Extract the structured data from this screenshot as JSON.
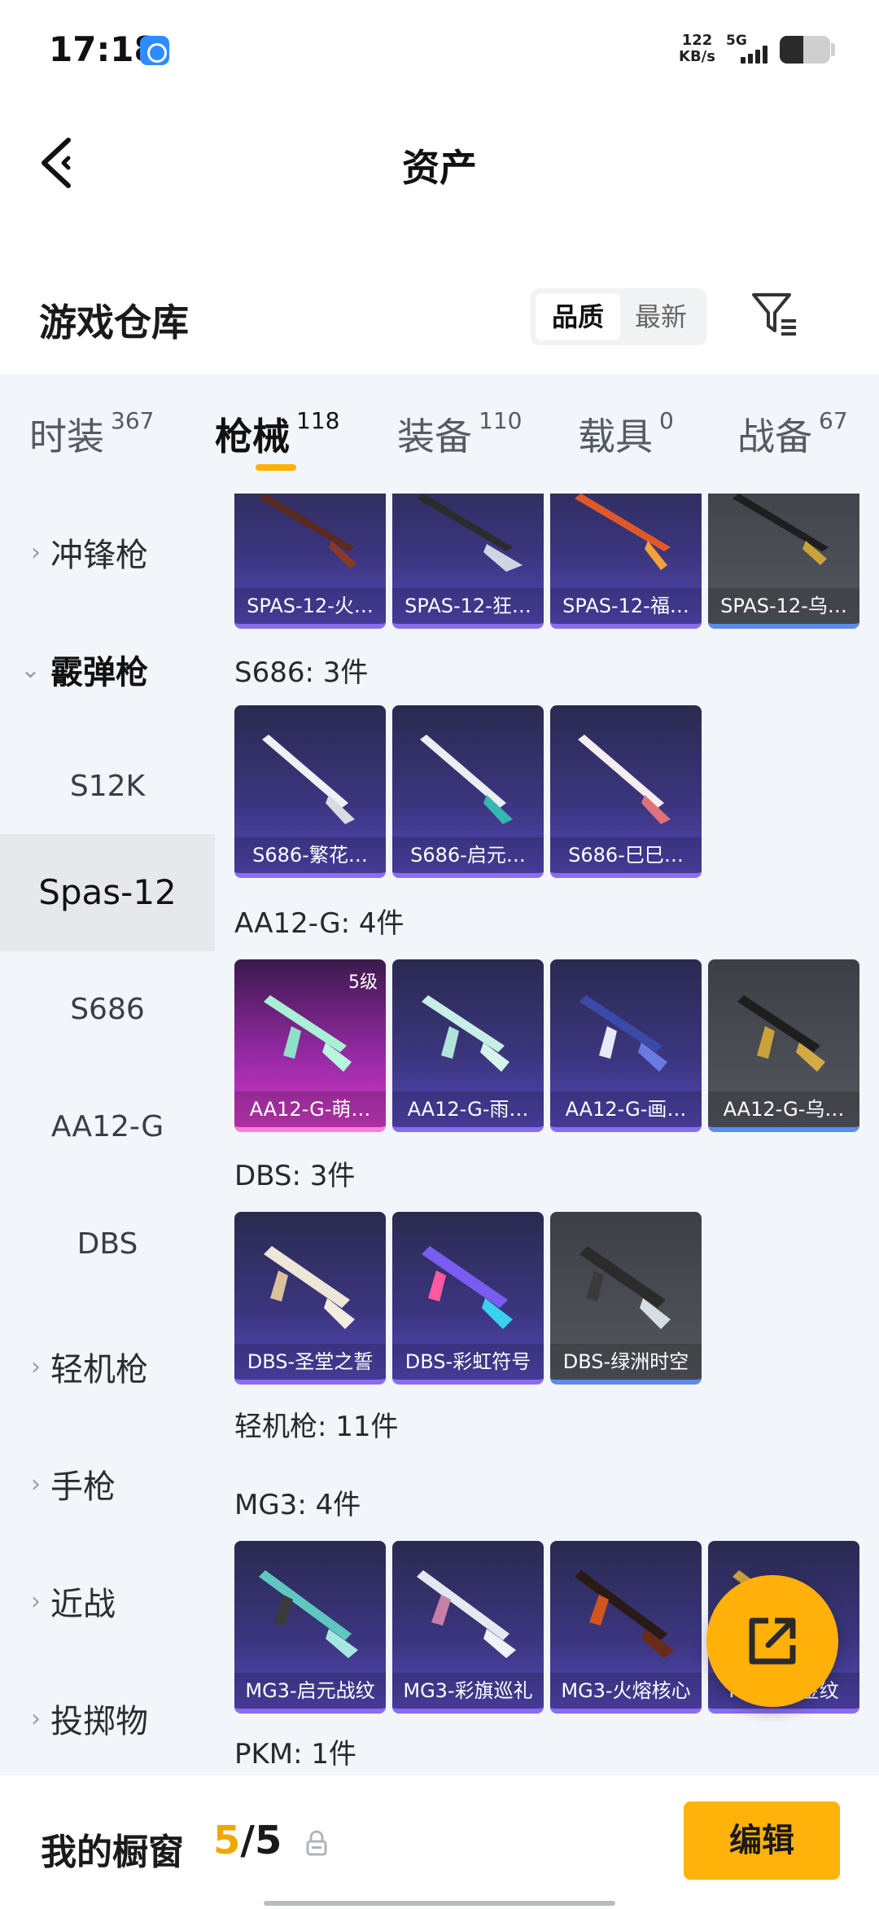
{
  "status_bar": {
    "time": "17:18",
    "net_speed": "122",
    "net_unit": "KB/s",
    "network": "5G"
  },
  "header": {
    "title": "资产"
  },
  "warehouse": {
    "title": "游戏仓库",
    "sort_options": [
      "品质",
      "最新"
    ],
    "sort_active": "品质"
  },
  "tabs": [
    {
      "label": "时装",
      "count": "367"
    },
    {
      "label": "枪械",
      "count": "118"
    },
    {
      "label": "装备",
      "count": "110"
    },
    {
      "label": "载具",
      "count": "0"
    },
    {
      "label": "战备",
      "count": "67"
    }
  ],
  "active_tab": "枪械",
  "sidebar": {
    "items": [
      {
        "label": "冲锋枪",
        "chevron": "›"
      },
      {
        "label": "霰弹枪",
        "chevron": "⌄"
      },
      {
        "label": "S12K"
      },
      {
        "label": "Spas-12"
      },
      {
        "label": "S686"
      },
      {
        "label": "AA12-G"
      },
      {
        "label": "DBS"
      },
      {
        "label": "轻机枪",
        "chevron": "›"
      },
      {
        "label": "手枪",
        "chevron": "›"
      },
      {
        "label": "近战",
        "chevron": "›"
      },
      {
        "label": "投掷物",
        "chevron": "›"
      }
    ]
  },
  "content": {
    "groups": [
      {
        "title": "",
        "cards": [
          "SPAS-12-火…",
          "SPAS-12-狂…",
          "SPAS-12-福…",
          "SPAS-12-乌…"
        ]
      },
      {
        "title": "S686: 3件",
        "cards": [
          "S686-繁花…",
          "S686-启元…",
          "S686-巳巳…"
        ]
      },
      {
        "title": "AA12-G: 4件",
        "cards": [
          "AA12-G-萌…",
          "AA12-G-雨…",
          "AA12-G-画…",
          "AA12-G-乌…"
        ],
        "badge": "5级"
      },
      {
        "title": "DBS: 3件",
        "cards": [
          "DBS-圣堂之誓",
          "DBS-彩虹符号",
          "DBS-绿洲时空"
        ]
      },
      {
        "title": "轻机枪: 11件"
      },
      {
        "title": "MG3: 4件",
        "cards": [
          "MG3-启元战纹",
          "MG3-彩旗巡礼",
          "MG3-火熔核心",
          "MG3-…金纹"
        ]
      },
      {
        "title": "PKM: 1件"
      }
    ]
  },
  "bottom": {
    "showcase_label": "我的橱窗",
    "showcase_current": "5",
    "showcase_sep": "/",
    "showcase_total": "5",
    "edit_label": "编辑"
  },
  "colors": {
    "accent": "#ffb10a",
    "tab_bg": "#f2f5f9"
  }
}
